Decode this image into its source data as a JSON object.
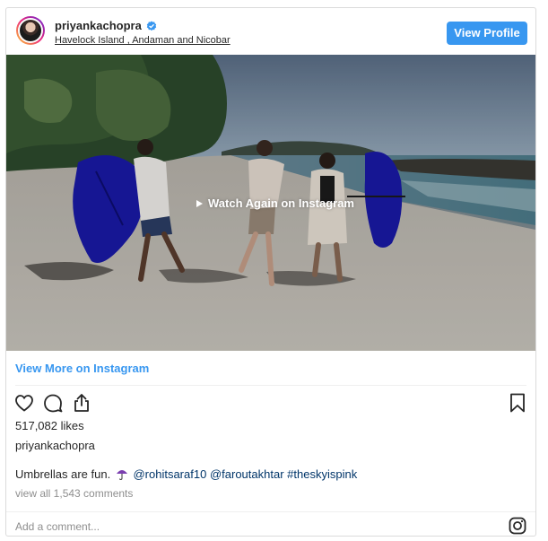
{
  "header": {
    "username": "priyankachopra",
    "location": "Havelock Island , Andaman and Nicobar",
    "view_profile_label": "View Profile",
    "verified_icon": "verified-badge-icon"
  },
  "media": {
    "overlay_label": "Watch Again on Instagram",
    "play_icon": "play-icon"
  },
  "links": {
    "view_more_label": "View More on Instagram"
  },
  "actions": {
    "icons": [
      "heart-icon",
      "comment-icon",
      "share-icon",
      "bookmark-icon"
    ]
  },
  "stats": {
    "likes": "517,082 likes"
  },
  "post": {
    "owner": "priyankachopra",
    "caption_text": "Umbrellas are fun.",
    "caption_emoji": "umbrella-emoji",
    "mention_1": "@rohitsaraf10",
    "mention_2": "@faroutakhtar",
    "hashtag": "#theskyispink",
    "view_all_comments": "view all 1,543 comments"
  },
  "comment": {
    "placeholder": "Add a comment..."
  },
  "colors": {
    "accent": "#3897f0",
    "link_dark": "#003569",
    "muted": "#8e8e8e",
    "border": "#dbdbdb",
    "umbrella_blue": "#1a1aa8"
  }
}
